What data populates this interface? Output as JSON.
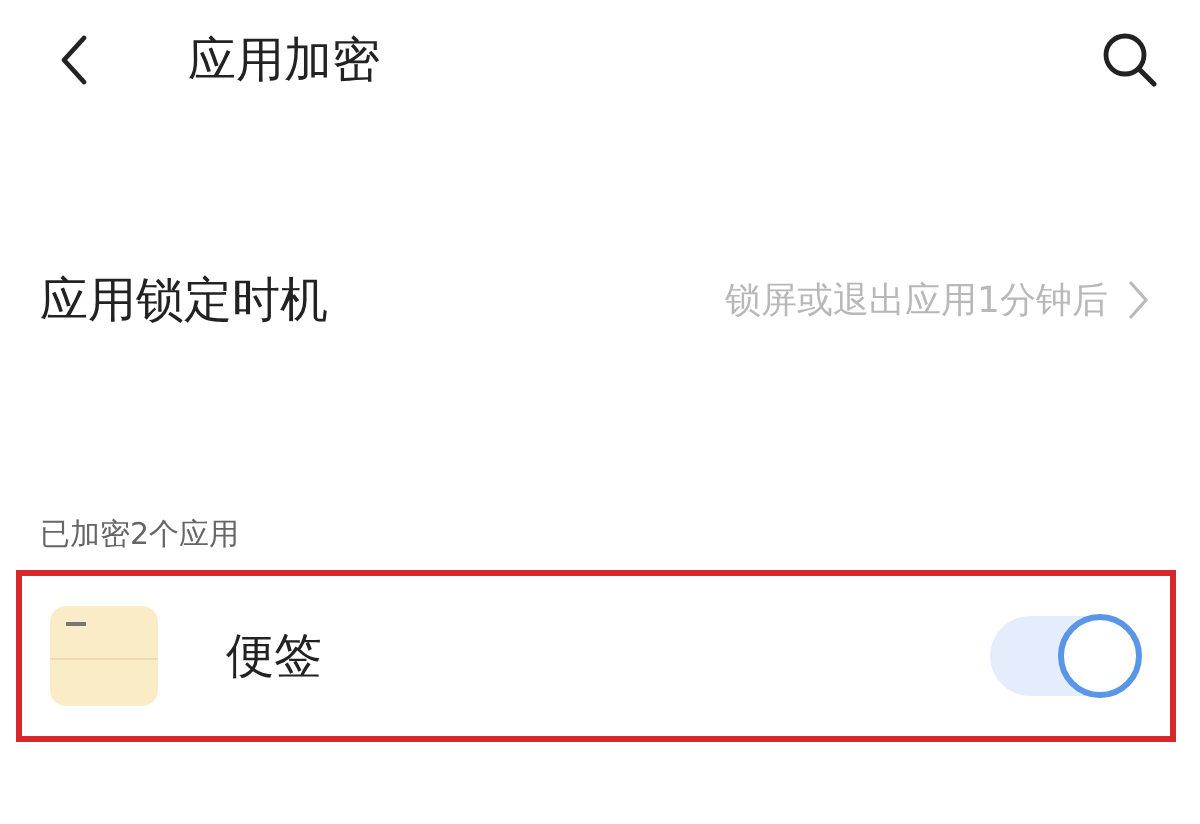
{
  "header": {
    "title": "应用加密"
  },
  "settings": [
    {
      "label": "应用锁定时机",
      "value": "锁屏或退出应用1分钟后"
    }
  ],
  "section": {
    "title": "已加密2个应用"
  },
  "apps": [
    {
      "name": "便签",
      "on": true,
      "highlighted": true
    }
  ]
}
